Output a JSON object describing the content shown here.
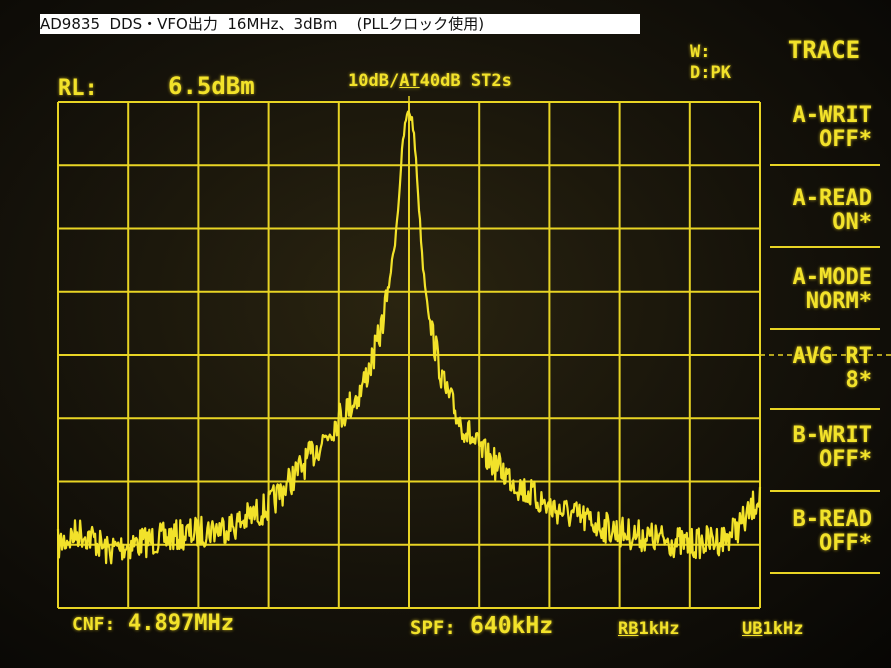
{
  "caption": "AD9835  DDS・VFO出力  16MHz、3dBm    (PLLクロック使用)",
  "header": {
    "rl_label": "RL:",
    "ref_level": "6.5dBm",
    "scale_div": "10dB/",
    "atten_label": "AT",
    "atten_value": "40dB",
    "sweep": "ST2s",
    "w_mode": "W:",
    "d_mode": "D:PK"
  },
  "softkeys": {
    "title": "TRACE",
    "items": [
      {
        "line1": "A-WRIT",
        "line2": "OFF*"
      },
      {
        "line1": "A-READ",
        "line2": "ON*"
      },
      {
        "line1": "A-MODE",
        "line2": "NORM*"
      },
      {
        "line1": "AVG RT",
        "line2": "8*"
      },
      {
        "line1": "B-WRIT",
        "line2": "OFF*"
      },
      {
        "line1": "B-READ",
        "line2": "OFF*"
      }
    ]
  },
  "footer": {
    "cnf_label": "CNF:",
    "cnf_value": "4.897MHz",
    "spf_label": "SPF:",
    "spf_value": "640kHz",
    "rb_label": "RB",
    "rb_value": "1kHz",
    "ub_label": "UB",
    "ub_value": "1kHz"
  },
  "colors": {
    "trace": "#f2e22a",
    "graticule": "#e8d424",
    "caption_bg": "#ffffff"
  },
  "chart_data": {
    "type": "line",
    "x_divisions": 10,
    "y_divisions": 8,
    "y_unit_per_div_db": 10,
    "ref_level_dbm": 6.5,
    "center_marker": "dashed vertical line at center frequency",
    "display_line_db_below_ref": 40,
    "series": [
      {
        "x_div": [
          0,
          0.3,
          0.5,
          0.7,
          1.0,
          1.5,
          2.0,
          2.5,
          3.0,
          3.3,
          3.6,
          3.8,
          4.0,
          4.3,
          4.5,
          4.6,
          4.7,
          4.8,
          4.85,
          4.9,
          4.95,
          5.0,
          5.05,
          5.1,
          5.15,
          5.2,
          5.3,
          5.4,
          5.5,
          5.7,
          6.0,
          6.3,
          6.6,
          7.0,
          7.5,
          8.0,
          8.5,
          9.0,
          9.5,
          9.8,
          10.0
        ],
        "y_div_below_ref": [
          7.0,
          6.8,
          6.9,
          7.1,
          7.0,
          6.9,
          6.8,
          6.7,
          6.4,
          6.0,
          5.6,
          5.3,
          5.0,
          4.6,
          4.0,
          3.6,
          3.0,
          2.2,
          1.6,
          0.8,
          0.3,
          0.15,
          0.3,
          0.9,
          1.8,
          2.6,
          3.5,
          4.0,
          4.5,
          5.0,
          5.5,
          5.8,
          6.1,
          6.4,
          6.6,
          6.8,
          6.9,
          7.0,
          6.9,
          6.6,
          6.2
        ]
      }
    ]
  }
}
